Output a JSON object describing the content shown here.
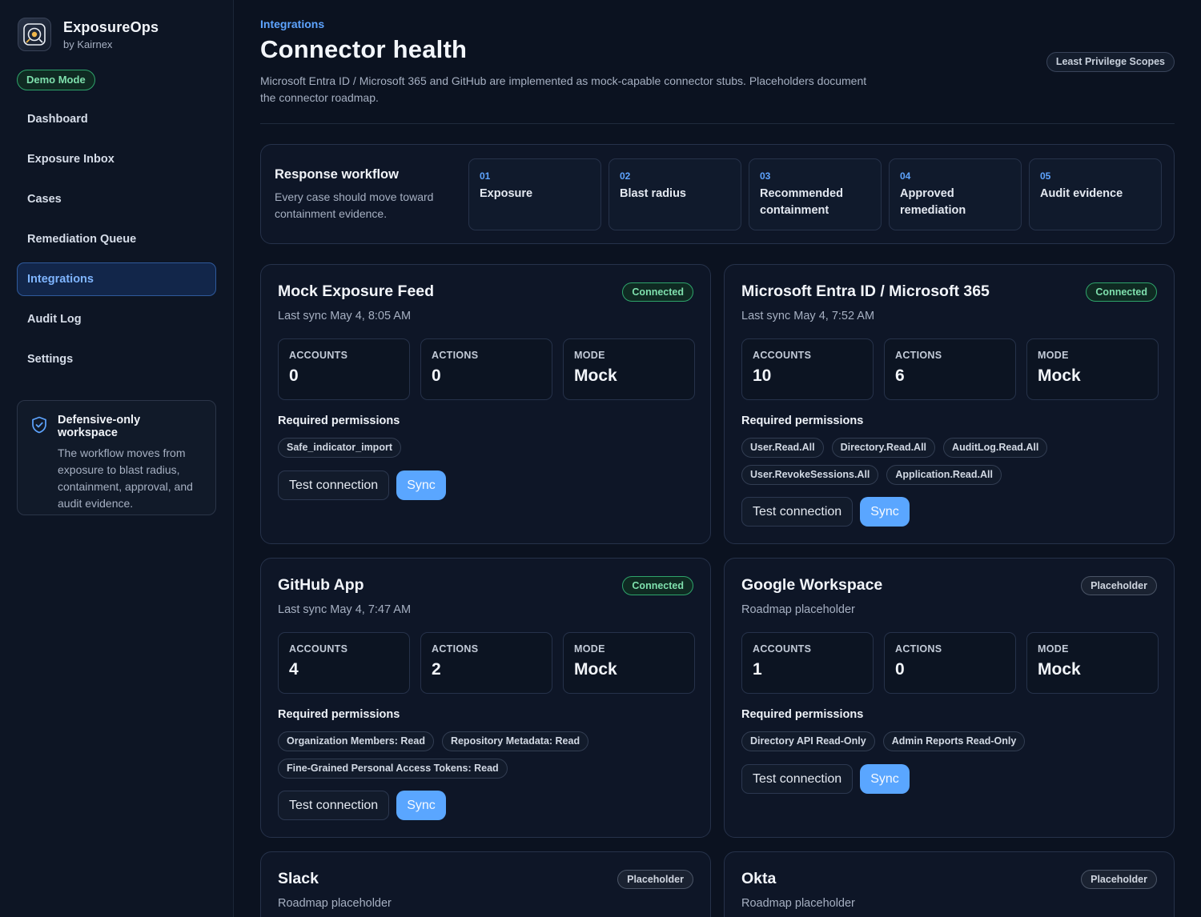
{
  "brand": {
    "name": "ExposureOps",
    "sub": "by Kairnex",
    "logo_icon": "radar-logo-icon"
  },
  "demo_badge": "Demo Mode",
  "nav": [
    {
      "label": "Dashboard",
      "active": false
    },
    {
      "label": "Exposure Inbox",
      "active": false
    },
    {
      "label": "Cases",
      "active": false
    },
    {
      "label": "Remediation Queue",
      "active": false
    },
    {
      "label": "Integrations",
      "active": true
    },
    {
      "label": "Audit Log",
      "active": false
    },
    {
      "label": "Settings",
      "active": false
    }
  ],
  "info_card": {
    "icon": "shield-check-icon",
    "title": "Defensive-only workspace",
    "text": "The workflow moves from exposure to blast radius, containment, approval, and audit evidence."
  },
  "header": {
    "breadcrumb": "Integrations",
    "title": "Connector health",
    "description": "Microsoft Entra ID / Microsoft 365 and GitHub are implemented as mock-capable connector stubs. Placeholders document the connector roadmap.",
    "scope_badge": "Least Privilege Scopes"
  },
  "workflow": {
    "title": "Response workflow",
    "text": "Every case should move toward containment evidence.",
    "steps": [
      {
        "num": "01",
        "label": "Exposure"
      },
      {
        "num": "02",
        "label": "Blast radius"
      },
      {
        "num": "03",
        "label": "Recommended containment"
      },
      {
        "num": "04",
        "label": "Approved remediation"
      },
      {
        "num": "05",
        "label": "Audit evidence"
      }
    ]
  },
  "labels": {
    "accounts": "ACCOUNTS",
    "actions": "ACTIONS",
    "mode": "MODE",
    "required_permissions": "Required permissions",
    "test_connection": "Test connection",
    "sync": "Sync"
  },
  "connectors": [
    {
      "name": "Mock Exposure Feed",
      "sub": "Last sync May 4, 8:05 AM",
      "status": "Connected",
      "accounts": "0",
      "actions": "0",
      "mode": "Mock",
      "permissions": [
        "Safe_indicator_import"
      ]
    },
    {
      "name": "Microsoft Entra ID / Microsoft 365",
      "sub": "Last sync May 4, 7:52 AM",
      "status": "Connected",
      "accounts": "10",
      "actions": "6",
      "mode": "Mock",
      "permissions": [
        "User.Read.All",
        "Directory.Read.All",
        "AuditLog.Read.All",
        "User.RevokeSessions.All",
        "Application.Read.All"
      ]
    },
    {
      "name": "GitHub App",
      "sub": "Last sync May 4, 7:47 AM",
      "status": "Connected",
      "accounts": "4",
      "actions": "2",
      "mode": "Mock",
      "permissions": [
        "Organization Members: Read",
        "Repository Metadata: Read",
        "Fine-Grained Personal Access Tokens: Read"
      ]
    },
    {
      "name": "Google Workspace",
      "sub": "Roadmap placeholder",
      "status": "Placeholder",
      "accounts": "1",
      "actions": "0",
      "mode": "Mock",
      "permissions": [
        "Directory API Read-Only",
        "Admin Reports Read-Only"
      ]
    },
    {
      "name": "Slack",
      "sub": "Roadmap placeholder",
      "status": "Placeholder"
    },
    {
      "name": "Okta",
      "sub": "Roadmap placeholder",
      "status": "Placeholder"
    }
  ]
}
